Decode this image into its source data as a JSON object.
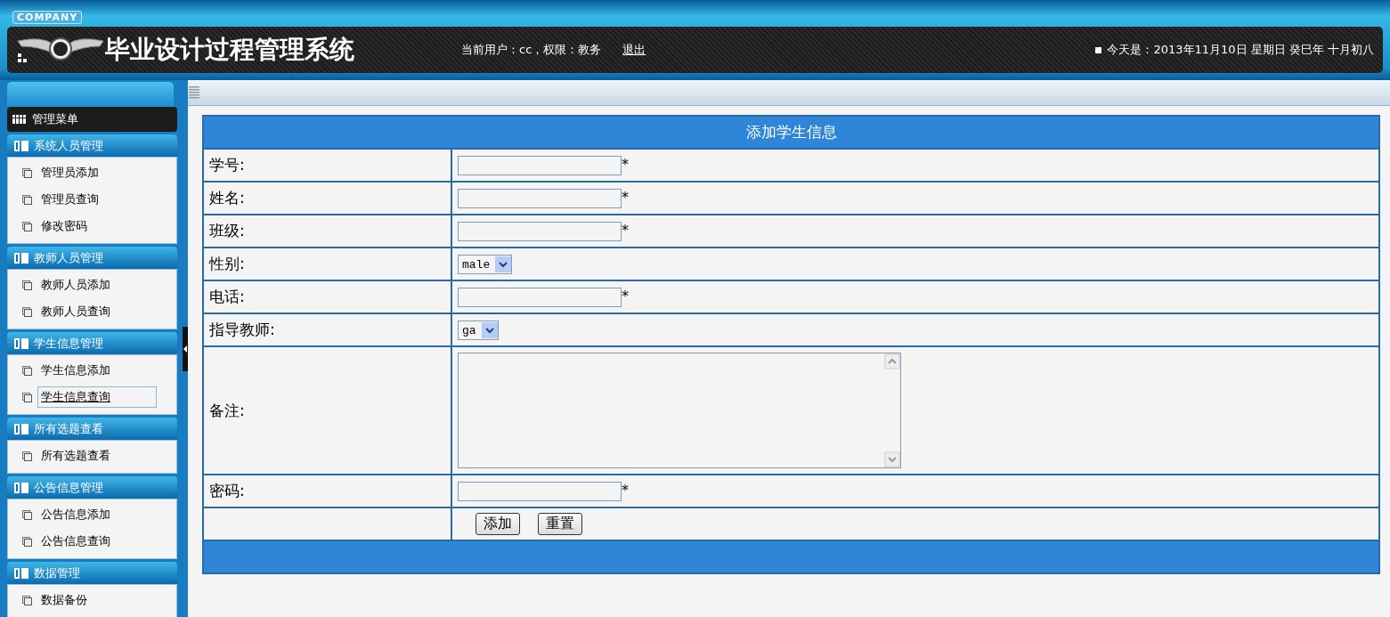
{
  "header": {
    "badge": "COMPANY",
    "title": "毕业设计过程管理系统",
    "user_info": "当前用户：cc，权限：教务",
    "logout": "退出",
    "date": "今天是：2013年11月10日 星期日 癸巳年 十月初八"
  },
  "sidebar": {
    "title": "管理菜单",
    "groups": [
      {
        "label": "系统人员管理",
        "items": [
          {
            "label": "管理员添加",
            "selected": false
          },
          {
            "label": "管理员查询",
            "selected": false
          },
          {
            "label": "修改密码",
            "selected": false
          }
        ]
      },
      {
        "label": "教师人员管理",
        "items": [
          {
            "label": "教师人员添加",
            "selected": false
          },
          {
            "label": "教师人员查询",
            "selected": false
          }
        ]
      },
      {
        "label": "学生信息管理",
        "items": [
          {
            "label": "学生信息添加",
            "selected": false
          },
          {
            "label": "学生信息查询",
            "selected": true
          }
        ]
      },
      {
        "label": "所有选题查看",
        "items": [
          {
            "label": "所有选题查看",
            "selected": false
          }
        ]
      },
      {
        "label": "公告信息管理",
        "items": [
          {
            "label": "公告信息添加",
            "selected": false
          },
          {
            "label": "公告信息查询",
            "selected": false
          }
        ]
      },
      {
        "label": "数据管理",
        "items": [
          {
            "label": "数据备份",
            "selected": false
          }
        ]
      }
    ]
  },
  "form": {
    "title": "添加学生信息",
    "rows": [
      {
        "kind": "text",
        "label": "学号:",
        "required_mark": "*"
      },
      {
        "kind": "text",
        "label": "姓名:",
        "required_mark": "*"
      },
      {
        "kind": "text",
        "label": "班级:",
        "required_mark": "*"
      },
      {
        "kind": "select",
        "label": "性别:",
        "value": "male"
      },
      {
        "kind": "text",
        "label": "电话:",
        "required_mark": "*"
      },
      {
        "kind": "select",
        "label": "指导教师:",
        "value": "ga"
      },
      {
        "kind": "textarea",
        "label": "备注:"
      },
      {
        "kind": "text",
        "label": "密码:",
        "required_mark": "*"
      },
      {
        "kind": "buttons",
        "buttons": [
          "添加",
          "重置"
        ]
      }
    ]
  }
}
